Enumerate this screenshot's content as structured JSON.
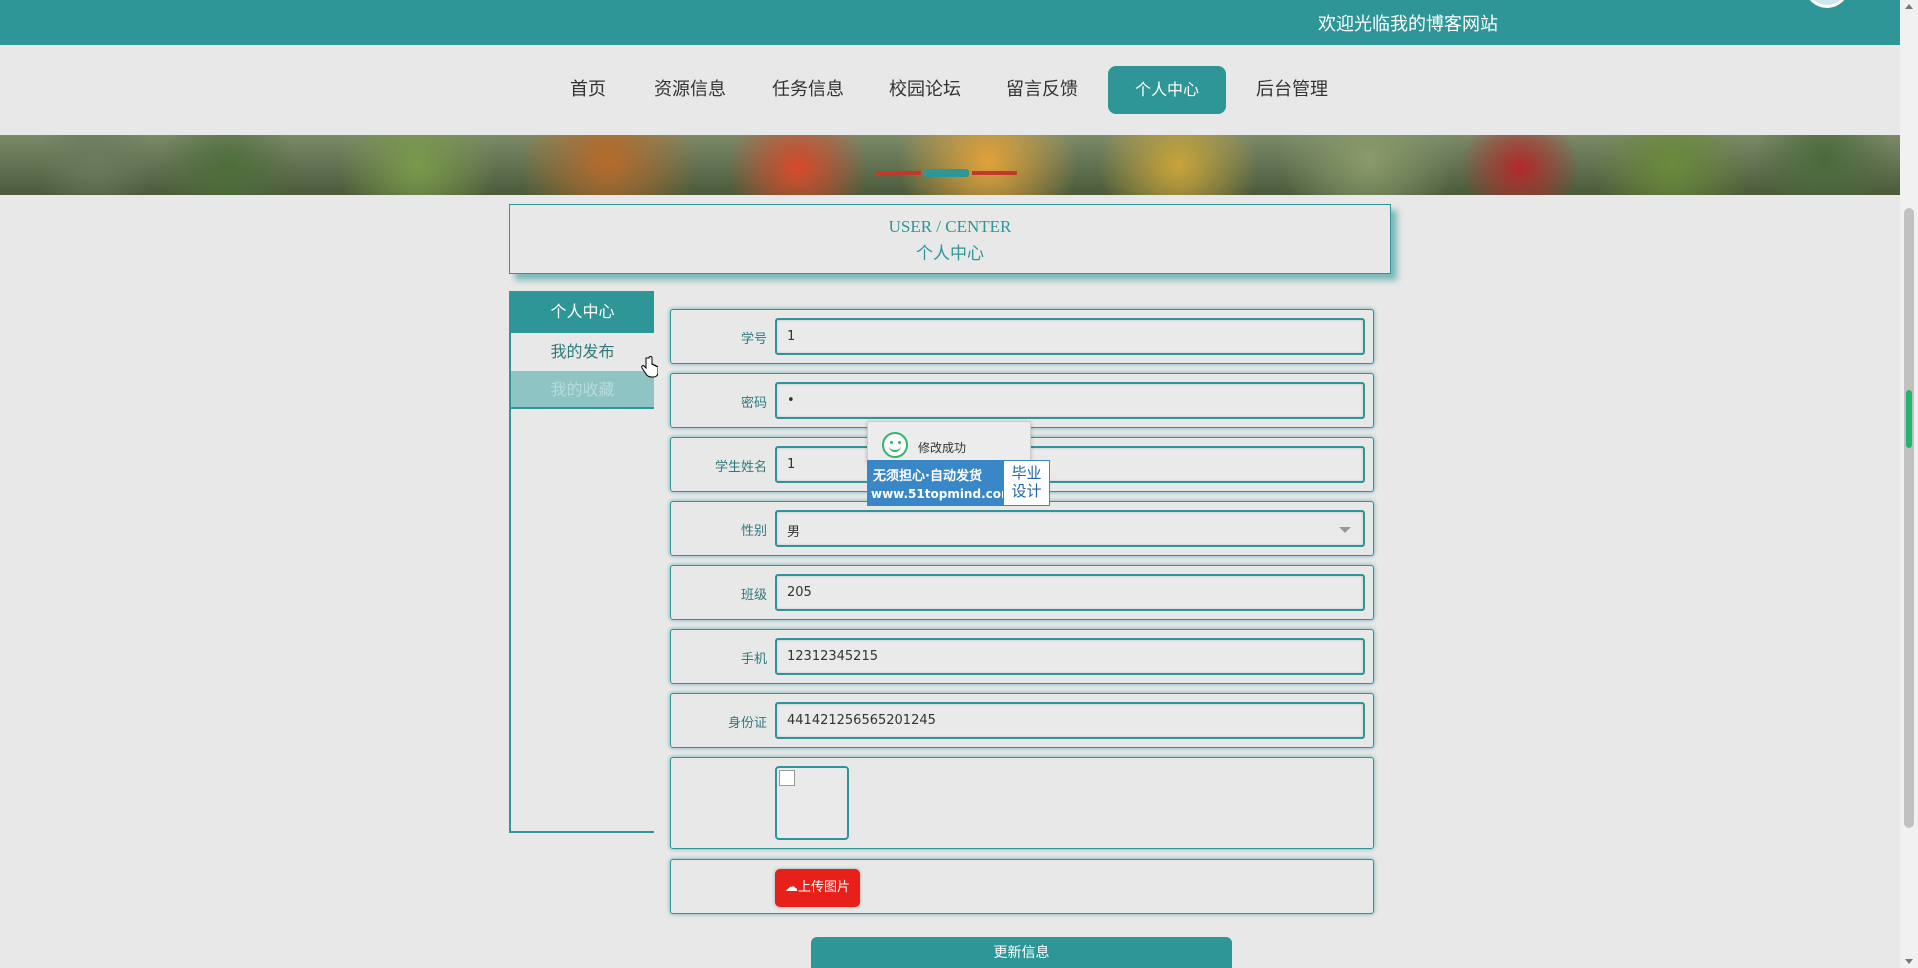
{
  "header": {
    "welcome": "欢迎光临我的博客网站"
  },
  "nav": {
    "items": [
      {
        "label": "首页"
      },
      {
        "label": "资源信息"
      },
      {
        "label": "任务信息"
      },
      {
        "label": "校园论坛"
      },
      {
        "label": "留言反馈"
      },
      {
        "label": "个人中心",
        "active": true
      },
      {
        "label": "后台管理"
      }
    ]
  },
  "page_title": {
    "en": "USER / CENTER",
    "zh": "个人中心"
  },
  "sidebar": {
    "header": "个人中心",
    "links": [
      {
        "label": "我的发布"
      },
      {
        "label": "我的收藏"
      }
    ]
  },
  "form": {
    "fields": [
      {
        "label": "学号",
        "value": "1"
      },
      {
        "label": "密码",
        "value": "•"
      },
      {
        "label": "学生姓名",
        "value": "1"
      },
      {
        "label": "性别",
        "value": "男"
      },
      {
        "label": "班级",
        "value": "205"
      },
      {
        "label": "手机",
        "value": "12312345215"
      },
      {
        "label": "身份证",
        "value": "441421256565201245"
      }
    ],
    "upload_label": "上传图片",
    "submit_label": "更新信息"
  },
  "toast": {
    "message": "修改成功"
  },
  "ad": {
    "line1": "无须担心·自动发货",
    "line2": "www.51topmind.com",
    "right_line1": "毕业",
    "right_line2": "设计"
  },
  "colors": {
    "primary": "#2e9696",
    "upload": "#e8201a",
    "background": "#e8e8e8"
  }
}
